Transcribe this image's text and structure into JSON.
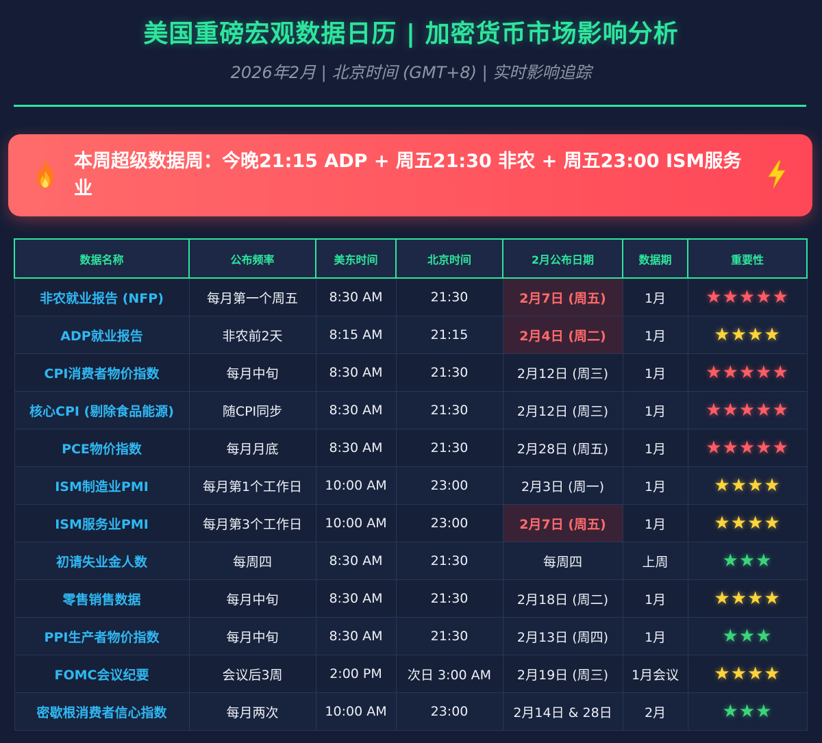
{
  "header": {
    "title": "美国重磅宏观数据日历 | 加密货币市场影响分析",
    "subtitle": "2026年2月 | 北京时间 (GMT+8) | 实时影响追踪"
  },
  "alert": {
    "text": "本周超级数据周：今晚21:15 ADP + 周五21:30 非农 + 周五23:00 ISM服务业",
    "left_icon": "fire-icon",
    "right_icon": "lightning-bolt-icon"
  },
  "colors": {
    "accent": "#2ee59d",
    "name_text": "#2fb8f2",
    "banner": "#ff5a5f",
    "hot_date": "#ff6b6b",
    "star_red": "#ff5c63",
    "star_yellow": "#ffd43b",
    "star_green": "#3ed47a"
  },
  "table": {
    "headers": [
      "数据名称",
      "公布频率",
      "美东时间",
      "北京时间",
      "2月公布日期",
      "数据期",
      "重要性"
    ],
    "rows": [
      {
        "name": "非农就业报告 (NFP)",
        "frequency": "每月第一个周五",
        "et_time": "8:30 AM",
        "bj_time": "21:30",
        "date": "2月7日 (周五)",
        "hot": true,
        "period": "1月",
        "stars": 5,
        "star_color": "red"
      },
      {
        "name": "ADP就业报告",
        "frequency": "非农前2天",
        "et_time": "8:15 AM",
        "bj_time": "21:15",
        "date": "2月4日 (周二)",
        "hot": true,
        "period": "1月",
        "stars": 4,
        "star_color": "yellow"
      },
      {
        "name": "CPI消费者物价指数",
        "frequency": "每月中旬",
        "et_time": "8:30 AM",
        "bj_time": "21:30",
        "date": "2月12日 (周三)",
        "hot": false,
        "period": "1月",
        "stars": 5,
        "star_color": "red"
      },
      {
        "name": "核心CPI (剔除食品能源)",
        "frequency": "随CPI同步",
        "et_time": "8:30 AM",
        "bj_time": "21:30",
        "date": "2月12日 (周三)",
        "hot": false,
        "period": "1月",
        "stars": 5,
        "star_color": "red"
      },
      {
        "name": "PCE物价指数",
        "frequency": "每月月底",
        "et_time": "8:30 AM",
        "bj_time": "21:30",
        "date": "2月28日 (周五)",
        "hot": false,
        "period": "1月",
        "stars": 5,
        "star_color": "red"
      },
      {
        "name": "ISM制造业PMI",
        "frequency": "每月第1个工作日",
        "et_time": "10:00 AM",
        "bj_time": "23:00",
        "date": "2月3日 (周一)",
        "hot": false,
        "period": "1月",
        "stars": 4,
        "star_color": "yellow"
      },
      {
        "name": "ISM服务业PMI",
        "frequency": "每月第3个工作日",
        "et_time": "10:00 AM",
        "bj_time": "23:00",
        "date": "2月7日 (周五)",
        "hot": true,
        "period": "1月",
        "stars": 4,
        "star_color": "yellow"
      },
      {
        "name": "初请失业金人数",
        "frequency": "每周四",
        "et_time": "8:30 AM",
        "bj_time": "21:30",
        "date": "每周四",
        "hot": false,
        "period": "上周",
        "stars": 3,
        "star_color": "green"
      },
      {
        "name": "零售销售数据",
        "frequency": "每月中旬",
        "et_time": "8:30 AM",
        "bj_time": "21:30",
        "date": "2月18日 (周二)",
        "hot": false,
        "period": "1月",
        "stars": 4,
        "star_color": "yellow"
      },
      {
        "name": "PPI生产者物价指数",
        "frequency": "每月中旬",
        "et_time": "8:30 AM",
        "bj_time": "21:30",
        "date": "2月13日 (周四)",
        "hot": false,
        "period": "1月",
        "stars": 3,
        "star_color": "green"
      },
      {
        "name": "FOMC会议纪要",
        "frequency": "会议后3周",
        "et_time": "2:00 PM",
        "bj_time": "次日 3:00 AM",
        "date": "2月19日 (周三)",
        "hot": false,
        "period": "1月会议",
        "stars": 4,
        "star_color": "yellow"
      },
      {
        "name": "密歇根消费者信心指数",
        "frequency": "每月两次",
        "et_time": "10:00 AM",
        "bj_time": "23:00",
        "date": "2月14日 & 28日",
        "hot": false,
        "period": "2月",
        "stars": 3,
        "star_color": "green"
      }
    ]
  }
}
